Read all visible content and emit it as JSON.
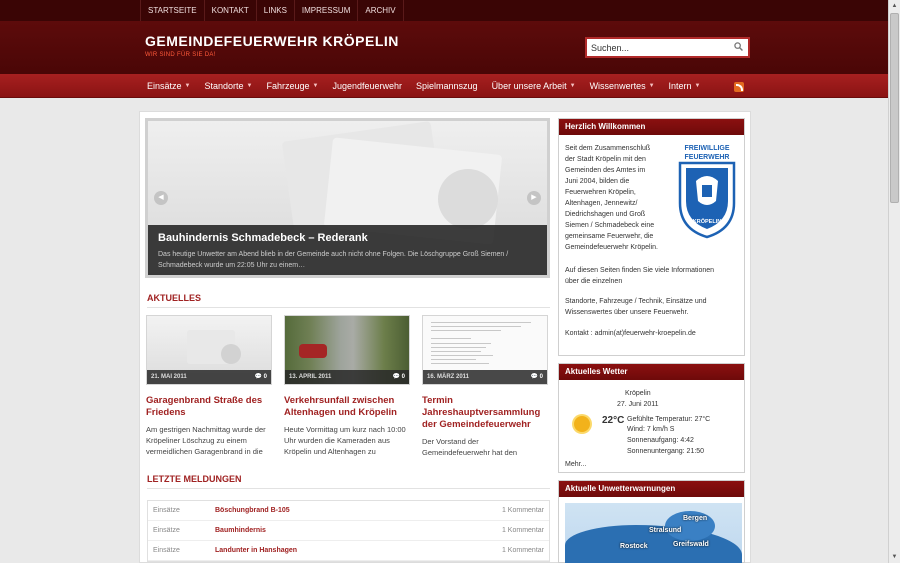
{
  "topnav": [
    "STARTSEITE",
    "KONTAKT",
    "LINKS",
    "IMPRESSUM",
    "ARCHIV"
  ],
  "site": {
    "title": "GEMEINDEFEUERWEHR KRÖPELIN",
    "tagline": "WIR SIND FÜR SIE DA!"
  },
  "search": {
    "value": "Suchen..."
  },
  "mainnav": [
    {
      "label": "Einsätze",
      "dropdown": true
    },
    {
      "label": "Standorte",
      "dropdown": true
    },
    {
      "label": "Fahrzeuge",
      "dropdown": true
    },
    {
      "label": "Jugendfeuerwehr",
      "dropdown": false
    },
    {
      "label": "Spielmannszug",
      "dropdown": false
    },
    {
      "label": "Über unsere Arbeit",
      "dropdown": true
    },
    {
      "label": "Wissenwertes",
      "dropdown": true
    },
    {
      "label": "Intern",
      "dropdown": true
    }
  ],
  "slider": {
    "title": "Bauhindernis Schmadebeck – Rederank",
    "text": "Das heutige Unwetter am Abend blieb in der Gemeinde auch nicht ohne Folgen. Die Löschgruppe Groß Siemen / Schmadebeck wurde um 22:05 Uhr zu einem…"
  },
  "aktuelles": {
    "heading": "AKTUELLES",
    "cards": [
      {
        "date": "21. MAI 2011",
        "comments": "0",
        "title": "Garagenbrand Straße des Friedens",
        "text": "Am gestrigen Nachmittag wurde der Kröpeliner Löschzug zu einem vermeidlichen Garagenbrand in die"
      },
      {
        "date": "13. APRIL 2011",
        "comments": "0",
        "title": "Verkehrsunfall zwischen Altenhagen und Kröpelin",
        "text": "Heute Vormittag um kurz nach 10:00 Uhr wurden die Kameraden aus Kröpelin und Altenhagen zu"
      },
      {
        "date": "16. MÄRZ 2011",
        "comments": "0",
        "title": "Termin Jahreshauptversammlung der Gemeindefeuerwehr",
        "text": "Der Vorstand der Gemeindefeuerwehr hat den"
      }
    ]
  },
  "meldungen": {
    "heading": "LETZTE MELDUNGEN",
    "rows": [
      {
        "category": "Einsätze",
        "title": "Böschungbrand B-105",
        "comments": "1 Kommentar"
      },
      {
        "category": "Einsätze",
        "title": "Baumhindernis",
        "comments": "1 Kommentar"
      },
      {
        "category": "Einsätze",
        "title": "Landunter in Hanshagen",
        "comments": "1 Kommentar"
      }
    ]
  },
  "welcome": {
    "heading": "Herzlich Willkommen",
    "para1": [
      "Seit dem Zusammenschluß",
      "der Stadt Kröpelin mit den",
      "Gemeinden des Amtes im",
      "Juni 2004, bilden die",
      "Feuerwehren Kröpelin,",
      "Altenhagen, Jennewitz/",
      "Diedrichshagen und Groß",
      "Siemen / Schmadebeck eine",
      "gemeinsame Feuerwehr, die",
      "Gemeindefeuerwehr Kröpelin."
    ],
    "para2": [
      "Auf diesen Seiten finden Sie viele Informationen",
      "über die einzelnen"
    ],
    "para3": [
      "Standorte, Fahrzeuge / Technik, Einsätze und",
      "Wissenswertes über unsere Feuerwehr."
    ],
    "contact": "Kontakt : admin(at)feuerwehr-kroepelin.de",
    "logo_top": "FREIWILLIGE",
    "logo_mid": "FEUERWEHR",
    "logo_bottom": "KRÖPELIN"
  },
  "weather": {
    "heading": "Aktuelles Wetter",
    "place": "Kröpelin",
    "date": "27. Juni 2011",
    "temp": "22°C",
    "feels": "Gefühlte Temperatur: 27°C",
    "wind": "Wind: 7 km/h S",
    "sunrise": "Sonnenaufgang: 4:42",
    "sunset": "Sonnenuntergang: 21:50",
    "more": "Mehr..."
  },
  "warnings": {
    "heading": "Aktuelle Unwetterwarnungen",
    "cities": [
      "Bergen",
      "Stralsund",
      "Rostock",
      "Greifswald"
    ]
  },
  "colors": {
    "dark_red": "#4a0606",
    "nav_red": "#a72020",
    "accent_red": "#a02222"
  }
}
